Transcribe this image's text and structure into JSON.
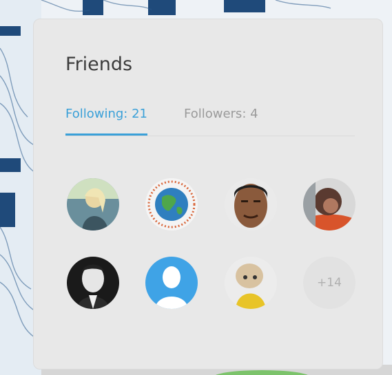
{
  "friends_card": {
    "title": "Friends",
    "tabs": [
      {
        "label": "Following: 21",
        "active": true
      },
      {
        "label": "Followers: 4",
        "active": false
      }
    ],
    "more_count_label": "+14",
    "accent_color": "#3aa0d8"
  }
}
